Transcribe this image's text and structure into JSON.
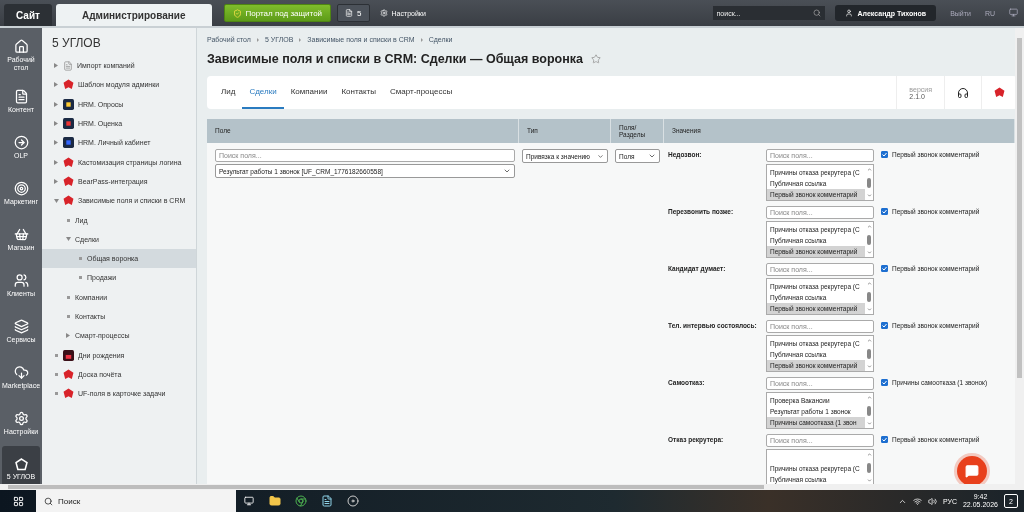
{
  "top_bar": {
    "tabs": [
      {
        "label": "Сайт",
        "selected": false
      },
      {
        "label": "Администрирование",
        "selected": true
      }
    ],
    "security_button": "Портал под защитой",
    "notifications_count": "5",
    "settings": "Настройки",
    "search": {
      "placeholder": "поиск..."
    },
    "user": "Александр Тихонов",
    "logout": "Выйти",
    "language": "RU"
  },
  "nav": [
    {
      "label": "Рабочий стол",
      "selected": false
    },
    {
      "label": "Контент",
      "selected": false
    },
    {
      "label": "OLP",
      "selected": false
    },
    {
      "label": "Маркетинг",
      "selected": false
    },
    {
      "label": "Магазин",
      "selected": false
    },
    {
      "label": "Клиенты",
      "selected": false
    },
    {
      "label": "Сервисы",
      "selected": false
    },
    {
      "label": "Marketplace",
      "selected": false
    },
    {
      "label": "Настройки",
      "selected": false
    },
    {
      "label": "5 УГЛОВ",
      "selected": true
    }
  ],
  "tree": {
    "title": "5 УГЛОВ",
    "items": [
      {
        "label": "Импорт компаний",
        "expanded": false,
        "selected": false
      },
      {
        "label": "Шаблон модуля админки",
        "expanded": false,
        "selected": false
      },
      {
        "label": "HRM. Опросы",
        "expanded": false,
        "selected": false
      },
      {
        "label": "HRM. Оценка",
        "expanded": false,
        "selected": false
      },
      {
        "label": "HRM. Личный кабинет",
        "expanded": false,
        "selected": false
      },
      {
        "label": "Кастомизация страницы логина",
        "expanded": false,
        "selected": false
      },
      {
        "label": "BearPass-интеграция",
        "expanded": false,
        "selected": false
      },
      {
        "label": "Зависимые поля и списки в CRM",
        "expanded": true,
        "selected": false,
        "children": [
          {
            "label": "Лид",
            "selected": false
          },
          {
            "label": "Сделки",
            "expanded": true,
            "selected": false,
            "children": [
              {
                "label": "Общая воронка",
                "selected": true
              },
              {
                "label": "Продажи",
                "selected": false
              }
            ]
          },
          {
            "label": "Компании",
            "selected": false
          },
          {
            "label": "Контакты",
            "selected": false
          },
          {
            "label": "Смарт-процессы",
            "expanded": false,
            "selected": false
          }
        ]
      },
      {
        "label": "Дни рождения",
        "selected": false
      },
      {
        "label": "Доска почёта",
        "selected": false
      },
      {
        "label": "UF-поля в карточке задачи",
        "selected": false
      }
    ]
  },
  "breadcrumbs": [
    "Рабочий стол",
    "5 УГЛОВ",
    "Зависимые поля и списки в CRM",
    "Сделки"
  ],
  "title": "Зависимые поля и списки в CRM: Сделки — Общая воронка",
  "tabs": [
    {
      "label": "Лид",
      "selected": false
    },
    {
      "label": "Сделки",
      "selected": true
    },
    {
      "label": "Компании",
      "selected": false
    },
    {
      "label": "Контакты",
      "selected": false
    },
    {
      "label": "Смарт-процессы",
      "selected": false
    }
  ],
  "version": {
    "label": "версия",
    "value": "2.1.0"
  },
  "table": {
    "columns": [
      "Поле",
      "Тип",
      "Поля/ Разделы",
      "Значения"
    ],
    "field": {
      "search": {
        "placeholder": "Поиск поля..."
      },
      "value": "Результат работы 1 звонок [UF_CRM_1776182660558]",
      "type": "Привязка к значению",
      "fields": "Поля"
    },
    "values": [
      {
        "label": "Недозвон:",
        "search": {
          "placeholder": "Поиск поля..."
        },
        "options": [
          {
            "text": "Причины отказа рекрутера (С",
            "selected": false
          },
          {
            "text": "Публичная ссылка",
            "selected": false
          },
          {
            "text": "Первый звонок комментарий",
            "selected": true
          }
        ],
        "checked": true,
        "checkbox_label": "Первый звонок комментарий"
      },
      {
        "label": "Перезвонить позже:",
        "search": {
          "placeholder": "Поиск поля..."
        },
        "options": [
          {
            "text": "Причины отказа рекрутера (С",
            "selected": false
          },
          {
            "text": "Публичная ссылка",
            "selected": false
          },
          {
            "text": "Первый звонок комментарий",
            "selected": true
          }
        ],
        "checked": true,
        "checkbox_label": "Первый звонок комментарий"
      },
      {
        "label": "Кандидат думает:",
        "search": {
          "placeholder": "Поиск поля..."
        },
        "options": [
          {
            "text": "Причины отказа рекрутера (С",
            "selected": false
          },
          {
            "text": "Публичная ссылка",
            "selected": false
          },
          {
            "text": "Первый звонок комментарий",
            "selected": true
          }
        ],
        "checked": true,
        "checkbox_label": "Первый звонок комментарий"
      },
      {
        "label": "Тел. интервью состоялось:",
        "search": {
          "placeholder": "Поиск поля..."
        },
        "options": [
          {
            "text": "Причины отказа рекрутера (С",
            "selected": false
          },
          {
            "text": "Публичная ссылка",
            "selected": false
          },
          {
            "text": "Первый звонок комментарий",
            "selected": true
          }
        ],
        "checked": true,
        "checkbox_label": "Первый звонок комментарий"
      },
      {
        "label": "Самоотказ:",
        "search": {
          "placeholder": "Поиск поля..."
        },
        "options": [
          {
            "text": "Проверка Вакансии",
            "selected": false
          },
          {
            "text": "Результат работы 1 звонок",
            "selected": false
          },
          {
            "text": "Причины самоотказа (1 звон",
            "selected": true
          }
        ],
        "checked": true,
        "checkbox_label": "Причины самоотказа (1 звонок)"
      },
      {
        "label": "Отказ рекрутера:",
        "search": {
          "placeholder": "Поиск поля..."
        },
        "options": [
          {
            "text": "Причины отказа рекрутера (С",
            "selected": false
          },
          {
            "text": "Публичная ссылка",
            "selected": false
          }
        ],
        "checked": true,
        "checkbox_label": "Первый звонок комментарий"
      }
    ]
  },
  "taskbar": {
    "search": {
      "placeholder": "Поиск"
    },
    "language": "РУС",
    "time": "9:42",
    "date": "22.05.2026",
    "notifications": "2"
  }
}
